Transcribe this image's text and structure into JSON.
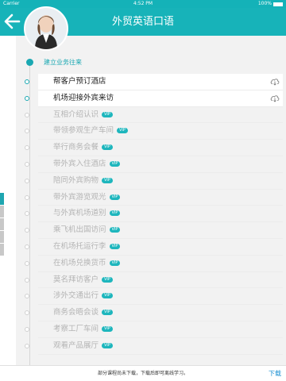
{
  "status": {
    "carrier": "Carrier",
    "time": "4:52 PM",
    "battery": "100%"
  },
  "nav": {
    "title": "外贸英语口语"
  },
  "section": {
    "title": "建立业务往来"
  },
  "lessons": [
    {
      "title": "帮客户预订酒店",
      "locked": false
    },
    {
      "title": "机场迎接外宾来访",
      "locked": false
    },
    {
      "title": "互相介绍认识",
      "locked": true
    },
    {
      "title": "带领参观生产车间",
      "locked": true
    },
    {
      "title": "举行商务会餐",
      "locked": true
    },
    {
      "title": "带外宾入住酒店",
      "locked": true
    },
    {
      "title": "陪同外宾购物",
      "locked": true
    },
    {
      "title": "带外宾游览观光",
      "locked": true
    },
    {
      "title": "与外宾机场道别",
      "locked": true
    },
    {
      "title": "乘飞机出国访问",
      "locked": true
    },
    {
      "title": "在机场托运行李",
      "locked": true
    },
    {
      "title": "在机场兑换货币",
      "locked": true
    },
    {
      "title": "莫名拜访客户",
      "locked": true
    },
    {
      "title": "涉外交通出行",
      "locked": true
    },
    {
      "title": "商务会晤会谈",
      "locked": true
    },
    {
      "title": "考察工厂车间",
      "locked": true
    },
    {
      "title": "观看产品展厅",
      "locked": true
    }
  ],
  "vip_label": "VIP",
  "bottom": {
    "message": "部分课程尚未下载，下载后即可离线学习。",
    "download_label": "下载"
  },
  "colors": {
    "accent": "#17b3b9",
    "link": "#1a8fd2"
  }
}
